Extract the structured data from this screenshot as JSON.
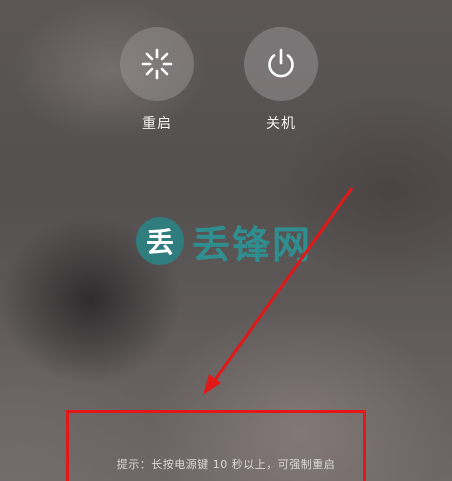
{
  "power_menu": {
    "restart": {
      "label": "重启",
      "icon": "restart-icon"
    },
    "shutdown": {
      "label": "关机",
      "icon": "power-icon"
    }
  },
  "watermark": {
    "logo_char": "丢",
    "text": "丢锋网"
  },
  "hint": {
    "text": "提示：长按电源键 10 秒以上，可强制重启"
  },
  "annotation": {
    "color": "#e01818"
  }
}
